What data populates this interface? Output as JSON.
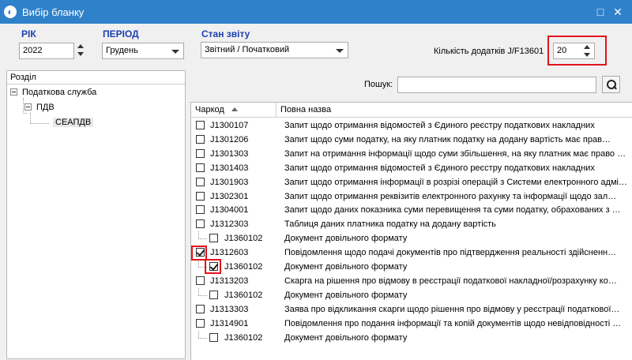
{
  "window": {
    "title": "Вибір бланку",
    "maximize_glyph": "□",
    "close_glyph": "✕",
    "app_icon": "app-logo-icon"
  },
  "filters": {
    "year_label": "РІК",
    "year_value": "2022",
    "period_label": "ПЕРІОД",
    "period_value": "Грудень",
    "status_label": "Стан звіту",
    "status_value": "Звітний / Початковий",
    "attachments_label": "Кількість додатків J/F13601",
    "attachments_value": "20"
  },
  "tree": {
    "header": "Розділ",
    "nodes": [
      {
        "label": "Податкова служба"
      },
      {
        "label": "ПДВ"
      },
      {
        "label": "СЕАПДВ"
      }
    ]
  },
  "search": {
    "label": "Пошук:",
    "value": ""
  },
  "grid": {
    "col_code": "Чаркод",
    "col_name": "Повна назва",
    "rows": [
      {
        "code": "J1300107",
        "name": "Запит щодо отримання відомостей з Єдиного реєстру податкових накладних",
        "checked": false,
        "child": false
      },
      {
        "code": "J1301206",
        "name": "Запит щодо суми податку, на яку платник податку на додану вартість має прав…",
        "checked": false,
        "child": false
      },
      {
        "code": "J1301303",
        "name": "Запит на отримання інформації щодо суми збільшення, на яку платник має право …",
        "checked": false,
        "child": false
      },
      {
        "code": "J1301403",
        "name": "Запит щодо отримання відомостей з Єдиного реєстру податкових накладних",
        "checked": false,
        "child": false
      },
      {
        "code": "J1301903",
        "name": "Запит щодо отримання інформації в розрізі операцій з Системи електронного адмі…",
        "checked": false,
        "child": false
      },
      {
        "code": "J1302301",
        "name": "Запит щодо отримання реквізитів електронного рахунку та інформації щодо зал…",
        "checked": false,
        "child": false
      },
      {
        "code": "J1304001",
        "name": "Запит щодо даних показника суми перевищення та суми податку, обрахованих з …",
        "checked": false,
        "child": false
      },
      {
        "code": "J1312303",
        "name": "Таблиця даних платника податку на додану вартість",
        "checked": false,
        "child": false
      },
      {
        "code": "J1360102",
        "name": "Документ довільного формату",
        "checked": false,
        "child": true
      },
      {
        "code": "J1312603",
        "name": "Повідомлення щодо подачі документів про підтвердження реальності здійсненн…",
        "checked": true,
        "child": false
      },
      {
        "code": "J1360102",
        "name": "Документ довільного формату",
        "checked": true,
        "child": true
      },
      {
        "code": "J1313203",
        "name": "Скарга на рішення про відмову в реєстрації податкової накладної/розрахунку ко…",
        "checked": false,
        "child": false
      },
      {
        "code": "J1360102",
        "name": "Документ довільного формату",
        "checked": false,
        "child": true
      },
      {
        "code": "J1313303",
        "name": "Заява про відкликання скарги щодо рішення про відмову у реєстрації податкової…",
        "checked": false,
        "child": false
      },
      {
        "code": "J1314901",
        "name": "Повідомлення про подання інформації та копій документів щодо невідповідності …",
        "checked": false,
        "child": false
      },
      {
        "code": "J1360102",
        "name": "Документ довільного формату",
        "checked": false,
        "child": true
      }
    ]
  },
  "colors": {
    "titlebar": "#2f81c9",
    "accent_label": "#1d3fb0",
    "highlight": "#e1141c"
  }
}
